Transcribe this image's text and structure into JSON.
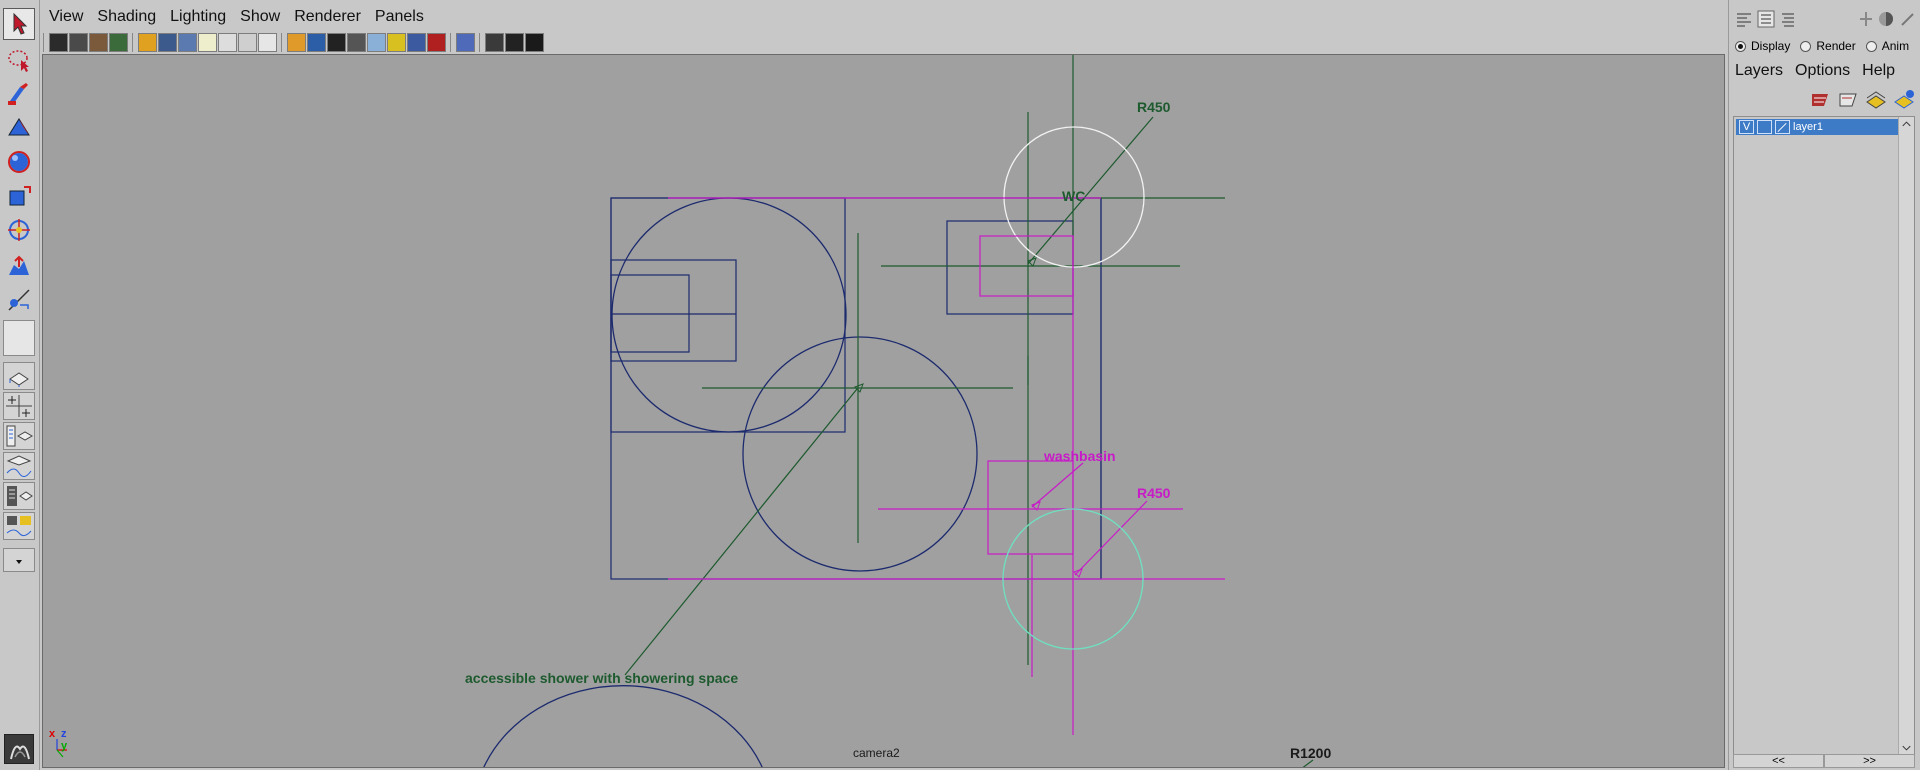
{
  "menubar": {
    "items": [
      "View",
      "Shading",
      "Lighting",
      "Show",
      "Renderer",
      "Panels"
    ]
  },
  "viewport": {
    "camera": "camera2",
    "axis": {
      "x": "x",
      "y": "y",
      "z": "z"
    },
    "annotations": {
      "r450_top": "R450",
      "wc": "WC",
      "washbasin": "washbasin",
      "r450_bottom": "R450",
      "shower": "accessible shower with showering space",
      "r1200": "R1200"
    },
    "colors": {
      "background": "#a0a0a0",
      "navy": "#1c2a6e",
      "magenta": "#c81bc8",
      "green": "#1d5a2e",
      "white": "#f2f2f2",
      "cyan": "#6fe0c0"
    }
  },
  "layer_editor": {
    "modes": [
      {
        "label": "Display",
        "selected": true
      },
      {
        "label": "Render",
        "selected": false
      },
      {
        "label": "Anim",
        "selected": false
      }
    ],
    "menu": [
      "Layers",
      "Options",
      "Help"
    ],
    "layer": {
      "visibility": "V",
      "name": "layer1"
    },
    "scroll": {
      "left": "<<",
      "right": ">>"
    }
  }
}
